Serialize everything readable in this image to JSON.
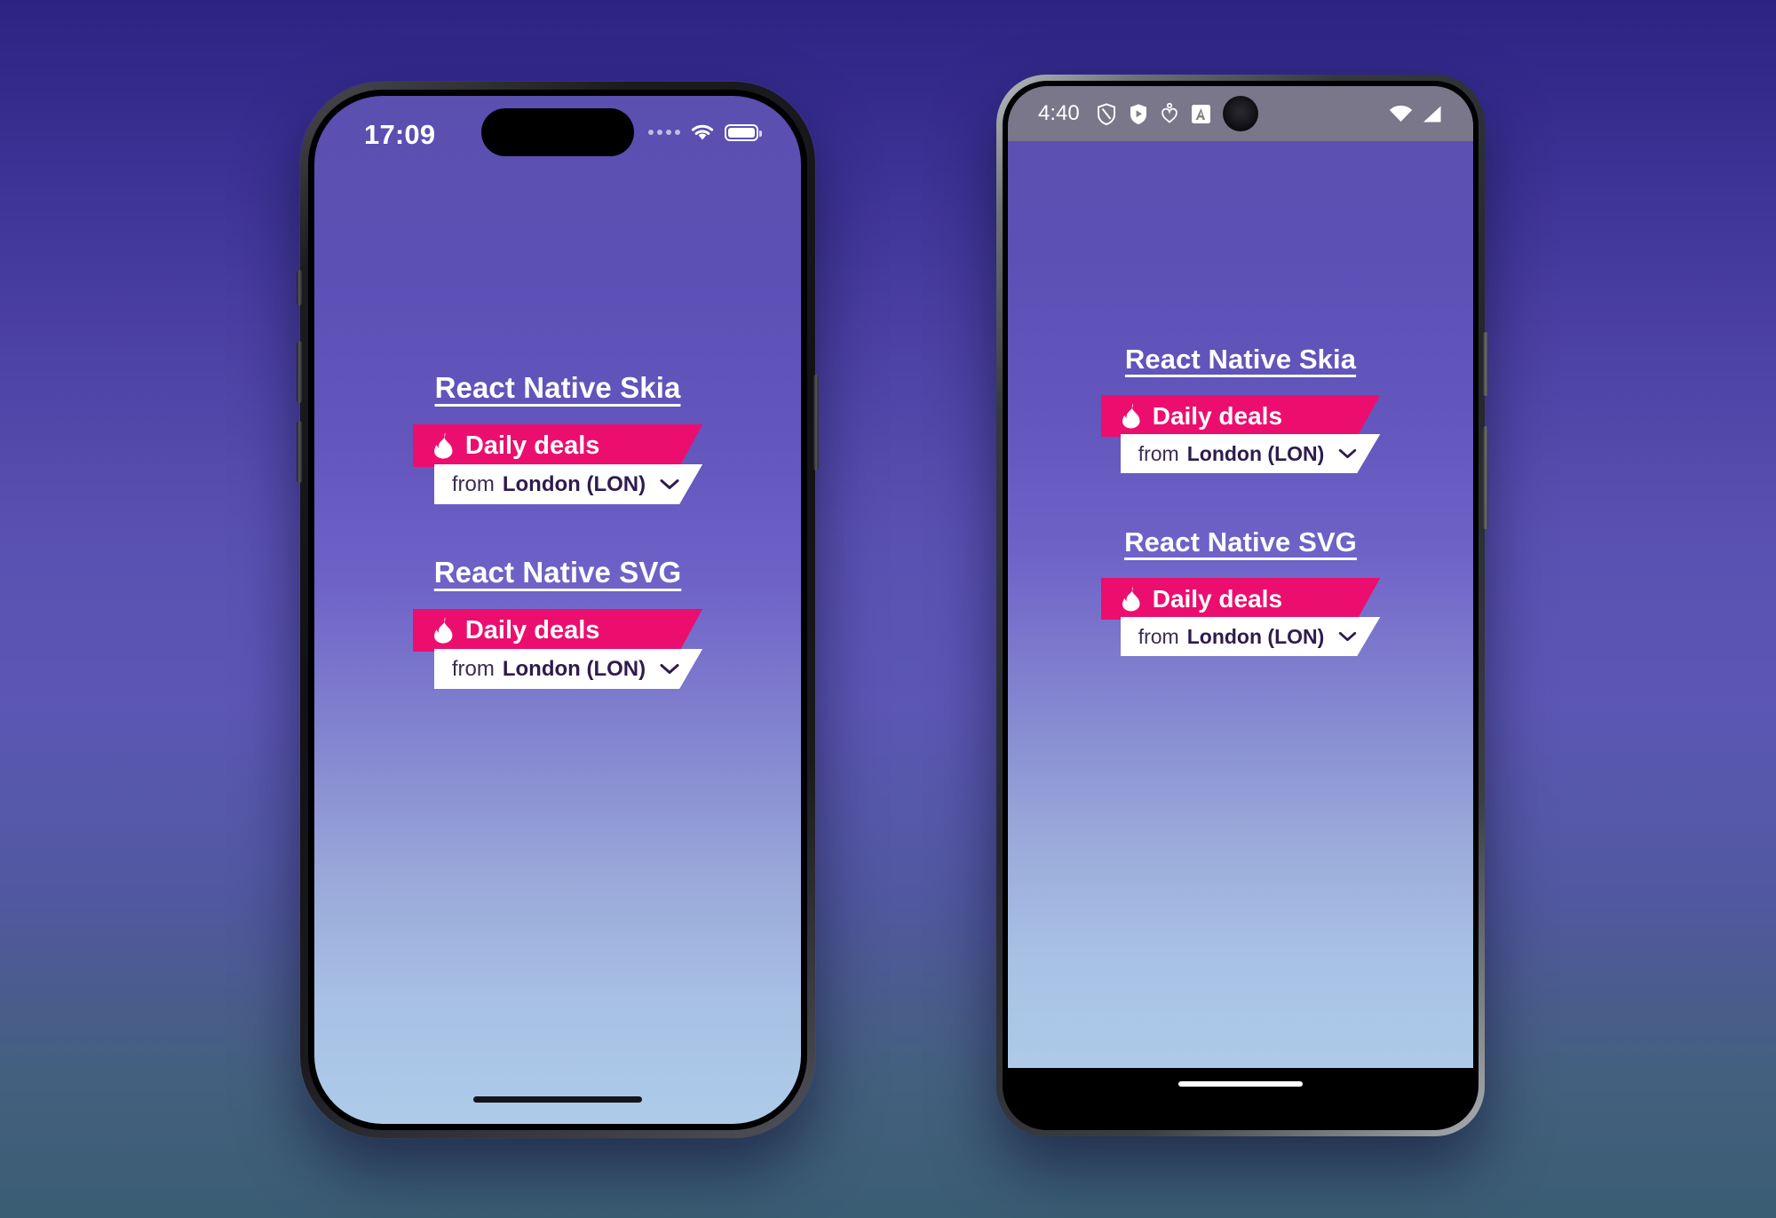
{
  "page": {
    "background_top": "#2d2383",
    "background_mid": "#5b57b4",
    "background_bottom": "#3a5d73"
  },
  "theme": {
    "accent_pink": "#ec0e6e",
    "screen_gradient_top": "#5b4fb0",
    "screen_gradient_bottom": "#aecbe9",
    "title_color": "#ffffff",
    "city_color": "#2f1b4e",
    "from_color": "#3a2b52"
  },
  "iphone": {
    "device_name": "iPhone",
    "status_bar": {
      "time": "17:09",
      "signal_icon": "signal-dots-icon",
      "wifi_icon": "wifi-icon",
      "battery_icon": "battery-icon",
      "notch_icon": "dynamic-island"
    },
    "home_indicator": "home-indicator",
    "sections": [
      {
        "title": "React Native Skia",
        "badge": {
          "ribbon_label": "Daily deals",
          "ribbon_icon": "flame-icon",
          "from_label": "from",
          "city_label": "London (LON)",
          "chevron_icon": "chevron-down-icon"
        }
      },
      {
        "title": "React Native SVG",
        "badge": {
          "ribbon_label": "Daily deals",
          "ribbon_icon": "flame-icon",
          "from_label": "from",
          "city_label": "London (LON)",
          "chevron_icon": "chevron-down-icon"
        }
      }
    ]
  },
  "android": {
    "device_name": "Android",
    "status_bar": {
      "time": "4:40",
      "icons": [
        "shield-outline-icon",
        "shield-play-icon",
        "heart-outline-icon",
        "a-badge-icon"
      ],
      "camera_icon": "camera-punch-hole",
      "wifi_icon": "wifi-icon",
      "signal_icon": "cell-signal-icon"
    },
    "home_indicator": "home-indicator",
    "sections": [
      {
        "title": "React Native Skia",
        "badge": {
          "ribbon_label": "Daily deals",
          "ribbon_icon": "flame-icon",
          "from_label": "from",
          "city_label": "London (LON)",
          "chevron_icon": "chevron-down-icon"
        }
      },
      {
        "title": "React Native SVG",
        "badge": {
          "ribbon_label": "Daily deals",
          "ribbon_icon": "flame-icon",
          "from_label": "from",
          "city_label": "London (LON)",
          "chevron_icon": "chevron-down-icon"
        }
      }
    ]
  }
}
